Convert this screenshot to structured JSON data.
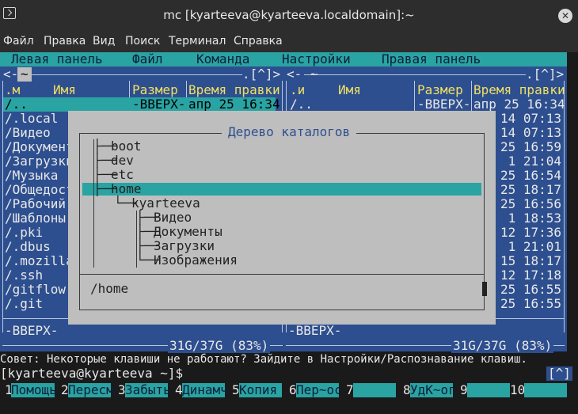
{
  "window": {
    "title": "mc [kyarteeva@kyarteeva.localdomain]:~",
    "close_glyph": "✕"
  },
  "app_menu": [
    "Файл",
    "Правка",
    "Вид",
    "Поиск",
    "Терминал",
    "Справка"
  ],
  "mc_menu": [
    "Левая панель",
    "Файл",
    "Команда",
    "Настройки",
    "Правая панель"
  ],
  "left_panel": {
    "header_left": "<-",
    "path": "~",
    "header_right": ".[^]>",
    "columns": {
      "sort": ".м",
      "name": "Имя",
      "size": "Размер",
      "time": "Время правки"
    },
    "selected_row": {
      "name": "/..",
      "size": "-ВВЕРХ-",
      "time": "апр 25 16:34"
    },
    "entries": [
      "/.local",
      "/Видео",
      "/Документ",
      "/Загрузки",
      "/Музыка",
      "/Общедост",
      "/Рабочий",
      "/Шаблоны",
      "/.pki",
      "/.dbus",
      "/.mozilla",
      "/.ssh",
      "/gitflow",
      "/.git"
    ],
    "status": "-ВВЕРХ-",
    "disk": "31G/37G (83%)"
  },
  "right_panel": {
    "header_left": "<-",
    "path": "~",
    "header_right": ".[^]>",
    "columns": {
      "sort": ".и",
      "name": "Имя",
      "size": "Размер",
      "time": "Время правки"
    },
    "selected_row": {
      "name": "/..",
      "size": "-ВВЕРХ-",
      "time": "апр 25 16:34"
    },
    "visible_times": [
      "14 07:13",
      "14 07:13",
      "25 16:59",
      " 1 21:04",
      "25 16:54",
      "25 18:17",
      "25 16:56",
      " 1 18:53",
      "12 17:36",
      " 1 21:01",
      "15 18:17",
      "12 17:18",
      "25 16:55",
      "25 16:55"
    ],
    "status": "-ВВЕРХ-",
    "disk": "31G/37G (83%)"
  },
  "tree_dialog": {
    "title": "Дерево каталогов",
    "items": [
      {
        "prefix": "├── ",
        "label": "boot"
      },
      {
        "prefix": "├── ",
        "label": "dev"
      },
      {
        "prefix": "├── ",
        "label": "etc"
      },
      {
        "prefix": "├── ",
        "label": "home"
      },
      {
        "prefix": "└── ",
        "label": "kyarteeva"
      },
      {
        "prefix": "├── ",
        "label": "Видео"
      },
      {
        "prefix": "├── ",
        "label": "Документы"
      },
      {
        "prefix": "├── ",
        "label": "Загрузки"
      },
      {
        "prefix": "└── ",
        "label": "Изображения"
      }
    ],
    "current_path": "/home"
  },
  "hint": "Совет: Некоторые клавиши не работают? Зайдите в Настройки/Распознавание клавиш.",
  "prompt": "[kyarteeva@kyarteeva ~]$",
  "prompt_indicator": "[^]",
  "fkeys": [
    {
      "num": "1",
      "label": "Помощь"
    },
    {
      "num": "2",
      "label": "Пересм"
    },
    {
      "num": "3",
      "label": "Забыть"
    },
    {
      "num": "4",
      "label": "Динамч"
    },
    {
      "num": "5",
      "label": "Копия"
    },
    {
      "num": "6",
      "label": "Пер~ос"
    },
    {
      "num": "7",
      "label": ""
    },
    {
      "num": "8",
      "label": "УдК~ог"
    },
    {
      "num": "9",
      "label": ""
    },
    {
      "num": "10",
      "label": ""
    }
  ]
}
